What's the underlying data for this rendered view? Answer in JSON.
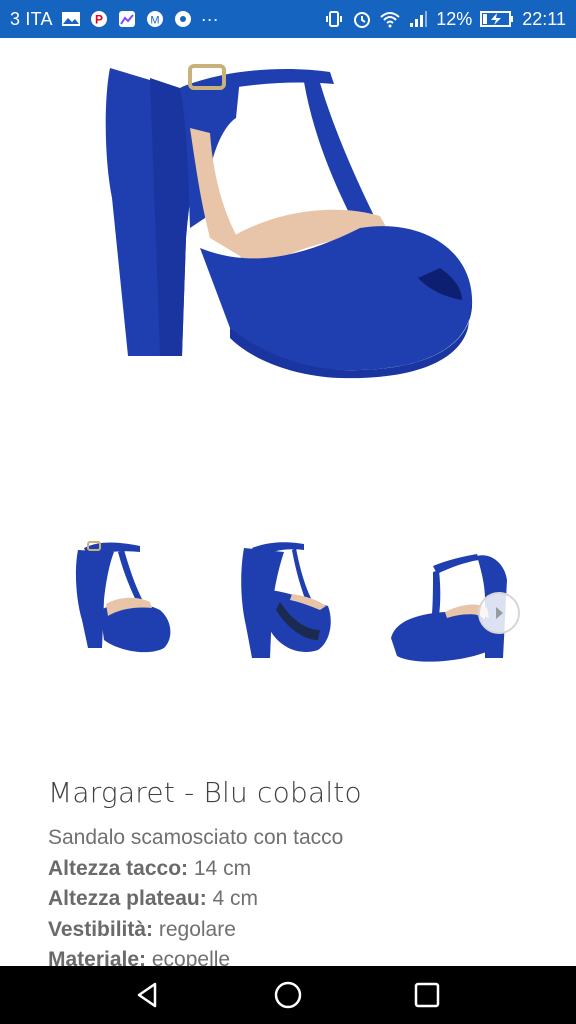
{
  "status_bar": {
    "carrier": "3 ITA",
    "overflow": "···",
    "battery_percent": "12%",
    "time": "22:11",
    "icons": [
      "photo-notification-icon",
      "pinterest-icon",
      "gallery-icon",
      "mail-icon",
      "vpn-icon",
      "vibrate-icon",
      "alarm-icon",
      "wifi-icon",
      "signal-icon",
      "battery-charging-icon"
    ]
  },
  "product": {
    "title": "Margaret - Blu cobalto",
    "description": "Sandalo scamosciato con tacco",
    "specs": [
      {
        "key": "Altezza tacco:",
        "value": " 14 cm"
      },
      {
        "key": "Altezza plateau:",
        "value": " 4 cm"
      },
      {
        "key": "Vestibilità:",
        "value": " regolare"
      },
      {
        "key": "Materiale:",
        "value": " ecopelle"
      }
    ]
  },
  "gallery": {
    "main_image": "cobalt-blue-platform-sandal",
    "thumbnails": [
      "sandal-side-view",
      "sandal-back-view",
      "sandal-front-view"
    ],
    "colors": {
      "shoe": "#1f3fb0",
      "lining": "#e8c4a8"
    }
  },
  "nav_bar": {
    "buttons": [
      "back-icon",
      "home-icon",
      "recents-icon"
    ]
  }
}
